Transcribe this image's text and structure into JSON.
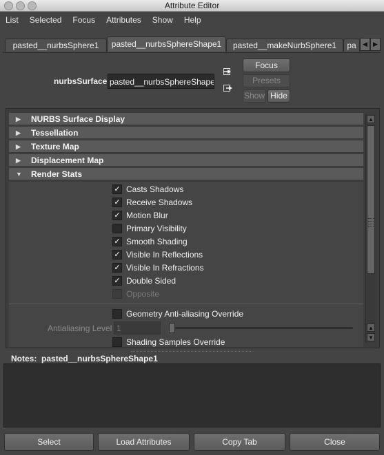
{
  "window": {
    "title": "Attribute Editor"
  },
  "menubar": [
    "List",
    "Selected",
    "Focus",
    "Attributes",
    "Show",
    "Help"
  ],
  "tabs": [
    {
      "label": "pasted__nurbsSphere1"
    },
    {
      "label": "pasted__nurbsSphereShape1"
    },
    {
      "label": "pasted__makeNurbSphere1"
    },
    {
      "label": "pa"
    }
  ],
  "node": {
    "type_label": "nurbsSurface:",
    "name": "pasted__nurbsSphereShape1"
  },
  "side_buttons": {
    "focus": "Focus",
    "presets": "Presets",
    "show": "Show",
    "hide": "Hide"
  },
  "sections": [
    {
      "label": "NURBS Surface Display",
      "expanded": false
    },
    {
      "label": "Tessellation",
      "expanded": false
    },
    {
      "label": "Texture Map",
      "expanded": false
    },
    {
      "label": "Displacement Map",
      "expanded": false
    },
    {
      "label": "Render Stats",
      "expanded": true
    }
  ],
  "render_stats": {
    "checkboxes": [
      {
        "label": "Casts Shadows",
        "checked": true,
        "enabled": true
      },
      {
        "label": "Receive Shadows",
        "checked": true,
        "enabled": true
      },
      {
        "label": "Motion Blur",
        "checked": true,
        "enabled": true
      },
      {
        "label": "Primary Visibility",
        "checked": false,
        "enabled": true
      },
      {
        "label": "Smooth Shading",
        "checked": true,
        "enabled": true
      },
      {
        "label": "Visible In Reflections",
        "checked": true,
        "enabled": true
      },
      {
        "label": "Visible In Refractions",
        "checked": true,
        "enabled": true
      },
      {
        "label": "Double Sided",
        "checked": true,
        "enabled": true
      },
      {
        "label": "Opposite",
        "checked": false,
        "enabled": false
      }
    ],
    "geometry_aa_override": {
      "label": "Geometry Anti-aliasing Override",
      "checked": false
    },
    "antialiasing_level": {
      "label": "Antialiasing Level",
      "value": "1"
    },
    "shading_samples_override": {
      "label": "Shading Samples Override",
      "checked": false
    }
  },
  "notes": {
    "label": "Notes:",
    "node_name": "pasted__nurbsSphereShape1"
  },
  "bottom_buttons": {
    "select": "Select",
    "load_attributes": "Load Attributes",
    "copy_tab": "Copy Tab",
    "close": "Close"
  },
  "check_mark": "✓",
  "icons": {
    "window_controls": [
      "close-icon",
      "minimize-icon",
      "zoom-icon"
    ],
    "input_connection": "input-connection-icon",
    "output_connection": "output-connection-icon",
    "expanded": "triangle-down-icon",
    "collapsed": "triangle-right-icon",
    "scroll_left": "arrow-left-icon",
    "scroll_right": "arrow-right-icon",
    "scroll_up": "arrow-up-icon",
    "scroll_down": "arrow-down-icon"
  },
  "colors": {
    "background": "#444444",
    "section_header": "#5a5a5a",
    "field": "#2b2b2b",
    "text": "#e6e6e6"
  }
}
